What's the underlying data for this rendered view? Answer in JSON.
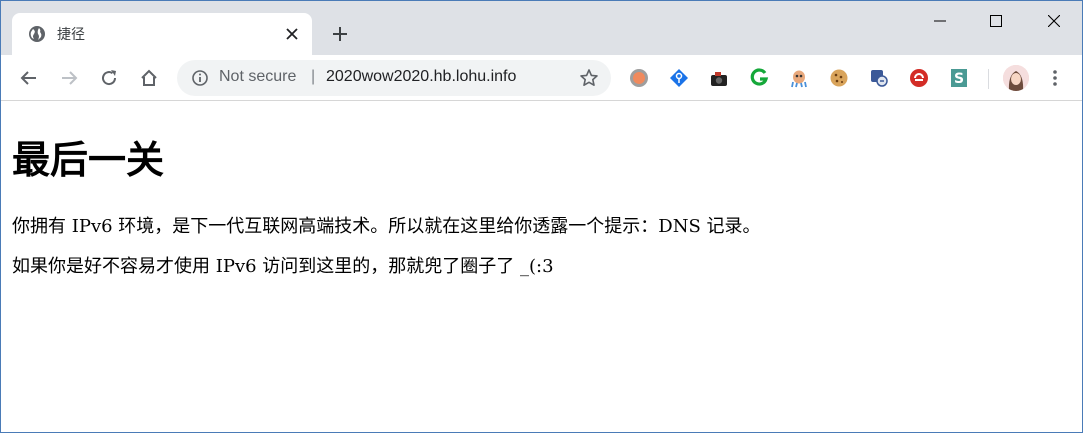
{
  "tab": {
    "title": "捷径",
    "favicon": "globe-icon"
  },
  "window_controls": {
    "minimize": "minimize-icon",
    "maximize": "maximize-icon",
    "close": "close-icon"
  },
  "toolbar": {
    "security_label": "Not secure",
    "separator": "|",
    "url": "2020wow2020.hb.lohu.info"
  },
  "extensions": [
    "record-icon",
    "key-icon",
    "camera-icon",
    "grammarly-icon",
    "octopus-icon",
    "cookie-icon",
    "scanner-icon",
    "lastpass-icon",
    "s-icon"
  ],
  "page": {
    "heading": "最后一关",
    "paragraphs": [
      "你拥有 IPv6 环境，是下一代互联网高端技术。所以就在这里给你透露一个提示：DNS 记录。",
      "如果你是好不容易才使用 IPv6 访问到这里的，那就兜了圈子了 _(:3"
    ]
  },
  "colors": {
    "tabstrip": "#dee1e6",
    "accent_border": "#4a7bb7"
  }
}
